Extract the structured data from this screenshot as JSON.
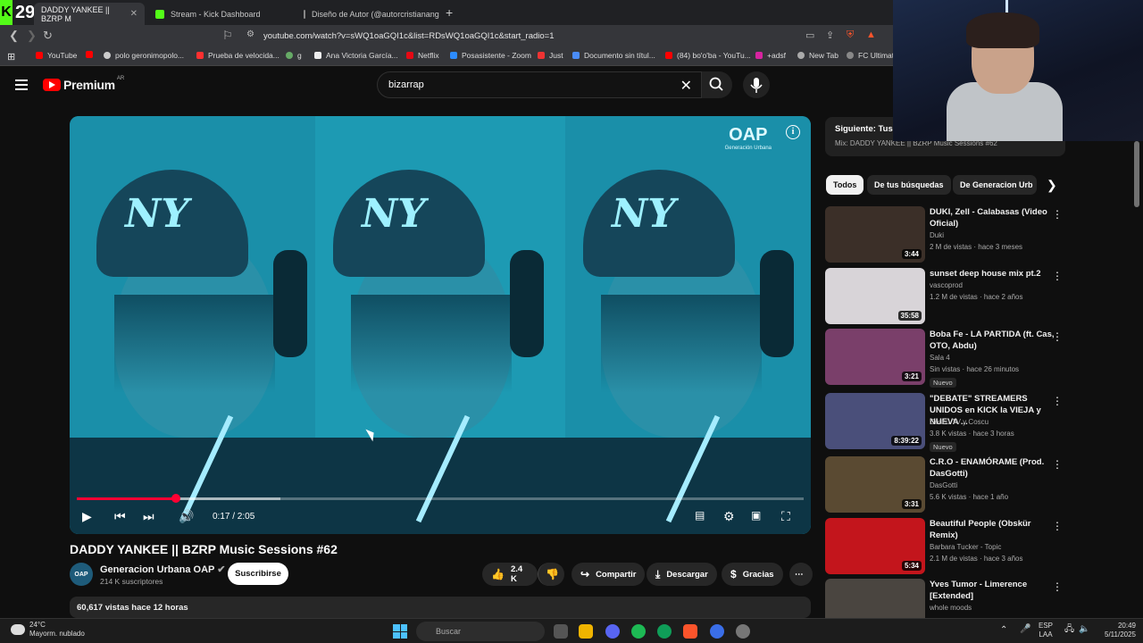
{
  "browser": {
    "kick_count": "29",
    "tabs": [
      {
        "label": "DADDY YANKEE || BZRP M",
        "active": true
      },
      {
        "label": "Stream - Kick Dashboard",
        "active": false
      },
      {
        "label": "Diseño de Autor (@autorcristianange",
        "active": false
      }
    ],
    "url": "youtube.com/watch?v=sWQ1oaGQI1c&list=RDsWQ1oaGQI1c&start_radio=1",
    "bookmarks": [
      "YouTube",
      "polo geronimopolo...",
      "Prueba de velocida...",
      "g",
      "Ana Victoria García...",
      "Netflix",
      "Posasistente - Zoom",
      "Just",
      "Documento sin títul...",
      "(84) bo'o'ba - YouTu...",
      "+adsf",
      "New Tab",
      "FC Ultimat"
    ]
  },
  "youtube": {
    "logo": "Premium",
    "region": "AR",
    "search_query": "bizarrap"
  },
  "player": {
    "time": "0:17 / 2:05",
    "progress": 0.136,
    "buffered": 0.28,
    "watermark": "OAP",
    "watermark_sub": "Generación Urbana"
  },
  "video": {
    "title": "DADDY YANKEE || BZRP Music Sessions #62",
    "channel": "Generacion Urbana OAP",
    "avatar_text": "OAP",
    "subscribers": "214 K suscriptores",
    "subscribe": "Suscribirse",
    "likes": "2.4 K",
    "share": "Compartir",
    "download": "Descargar",
    "thanks": "Gracias",
    "views_line": "60,617 vistas  hace 12 horas"
  },
  "sidebar": {
    "next_label": "Siguiente: Tus C",
    "next_sub": "Mix: DADDY YANKEE || BZRP Music Sessions #62",
    "chips": [
      "Todos",
      "De tus búsquedas",
      "De Generacion Urb"
    ],
    "recs": [
      {
        "title": "DUKI, Zell - Calabasas (Video Oficial)",
        "channel": "Duki",
        "meta": "2 M de vistas · hace 3 meses",
        "duration": "3:44",
        "badge": "",
        "color": "#3b2f28"
      },
      {
        "title": "sunset deep house mix pt.2",
        "channel": "vascoprod",
        "meta": "1.2 M de vistas · hace 2 años",
        "duration": "35:58",
        "badge": "",
        "color": "#d8d4d8"
      },
      {
        "title": "Boba Fe - LA PARTIDA (ft. Cas, OTO, Abdu)",
        "channel": "Sala 4",
        "meta": "Sin vistas · hace 26 minutos",
        "duration": "3:21",
        "badge": "Nuevo",
        "color": "#7a3f6a"
      },
      {
        "title": "\"DEBATE\" STREAMERS UNIDOS en KICK la VIEJA y NUEVA ...",
        "channel": "Coscu TV y Coscu",
        "meta": "3.8 K vistas · hace 3 horas",
        "duration": "8:39:22",
        "badge": "Nuevo",
        "color": "#4a4f7a"
      },
      {
        "title": "C.R.O - ENAMÓRAME (Prod. DasGotti)",
        "channel": "DasGotti",
        "meta": "5.6 K vistas · hace 1 año",
        "duration": "3:31",
        "badge": "",
        "color": "#5a4a32"
      },
      {
        "title": "Beautiful People (Obskür Remix)",
        "channel": "Barbara Tucker - Topic",
        "meta": "2.1 M de vistas · hace 3 años",
        "duration": "5:34",
        "badge": "",
        "color": "#c3151c"
      },
      {
        "title": "Yves Tumor - Limerence [Extended]",
        "channel": "whole moods",
        "meta": "",
        "duration": "",
        "badge": "",
        "color": "#4a4540"
      }
    ]
  },
  "taskbar": {
    "temp": "24°C",
    "weather": "Mayorm. nublado",
    "search": "Buscar",
    "lang1": "ESP",
    "lang2": "LAA",
    "time": "20:49",
    "date": "5/11/2025",
    "notif": "2"
  },
  "colors": {
    "accent": "#ff0033",
    "kick": "#53fc18",
    "video_tint": "#1a8aa6"
  }
}
